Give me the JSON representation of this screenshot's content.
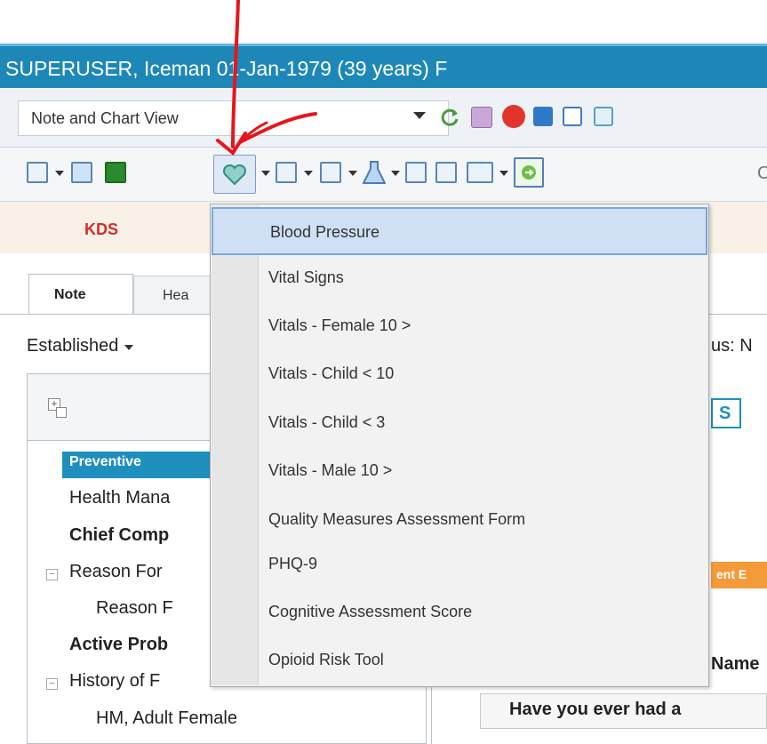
{
  "window": {
    "title": "SUPERUSER, Iceman  01-Jan-1979  (39 years)  F"
  },
  "view_selector": {
    "value": "Note and Chart View"
  },
  "toolbar": {
    "right_partial": "C"
  },
  "kds_label": "KDS",
  "tabs": [
    {
      "label": "Note"
    },
    {
      "label": "Hea"
    }
  ],
  "encounter_type": {
    "value": "Established"
  },
  "status_partial": "us: N",
  "tree": {
    "items": [
      {
        "label": "Preventive",
        "selected": true
      },
      {
        "label": "Health Mana"
      },
      {
        "label": "Chief Comp"
      },
      {
        "label": "Reason For"
      },
      {
        "label": "Reason F"
      },
      {
        "label": "Active Prob"
      },
      {
        "label": "History of F"
      },
      {
        "label": "HM, Adult Female"
      }
    ]
  },
  "right_pane": {
    "s_button": "S",
    "orange_button": "ent E",
    "name_label": "Name",
    "question": "Have you ever had a"
  },
  "dropdown_menu": {
    "items": [
      {
        "label": "Blood Pressure",
        "highlighted": true
      },
      {
        "label": "Vital Signs"
      },
      {
        "label": "Vitals - Female 10 >"
      },
      {
        "label": "Vitals - Child < 10"
      },
      {
        "label": "Vitals - Child < 3"
      },
      {
        "label": "Vitals - Male 10 >"
      },
      {
        "label": "Quality Measures Assessment Form"
      },
      {
        "label": "PHQ-9"
      },
      {
        "label": "Cognitive Assessment Score"
      },
      {
        "label": "Opioid Risk Tool"
      }
    ]
  },
  "colors": {
    "title_bar": "#1d88b8",
    "highlight": "#cfe0f4",
    "annotation": "#e5161c",
    "kds": "#d62b2b"
  }
}
